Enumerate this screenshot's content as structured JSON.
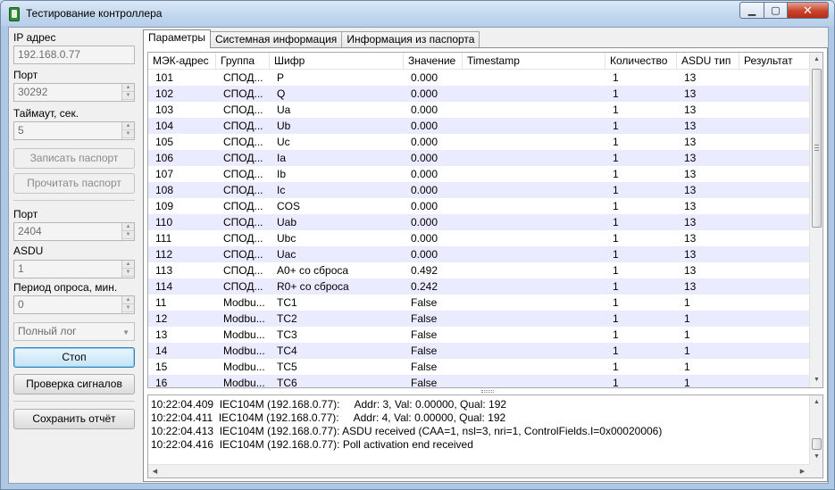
{
  "window": {
    "title": "Тестирование контроллера",
    "minimize_glyph": "▁",
    "maximize_glyph": "▢",
    "close_glyph": "✕"
  },
  "left": {
    "ip_label": "IP адрес",
    "ip_value": "192.168.0.77",
    "port_label": "Порт",
    "port_value": "30292",
    "timeout_label": "Таймаут, сек.",
    "timeout_value": "5",
    "write_passport": "Записать паспорт",
    "read_passport": "Прочитать паспорт",
    "port2_label": "Порт",
    "port2_value": "2404",
    "asdu_label": "ASDU",
    "asdu_value": "1",
    "poll_label": "Период опроса, мин.",
    "poll_value": "0",
    "log_mode": "Полный лог",
    "stop": "Стоп",
    "check_signals": "Проверка сигналов",
    "save_report": "Сохранить отчёт"
  },
  "tabs": [
    "Параметры",
    "Системная информация",
    "Информация из паспорта"
  ],
  "grid": {
    "columns": [
      "МЭК-адрес",
      "Группа",
      "Шифр",
      "Значение",
      "Timestamp",
      "Количество",
      "ASDU тип",
      "Результат"
    ],
    "rows": [
      [
        "101",
        "СПОД...",
        "P",
        "0.000",
        "",
        "1",
        "13",
        ""
      ],
      [
        "102",
        "СПОД...",
        "Q",
        "0.000",
        "",
        "1",
        "13",
        ""
      ],
      [
        "103",
        "СПОД...",
        "Ua",
        "0.000",
        "",
        "1",
        "13",
        ""
      ],
      [
        "104",
        "СПОД...",
        "Ub",
        "0.000",
        "",
        "1",
        "13",
        ""
      ],
      [
        "105",
        "СПОД...",
        "Uc",
        "0.000",
        "",
        "1",
        "13",
        ""
      ],
      [
        "106",
        "СПОД...",
        "Ia",
        "0.000",
        "",
        "1",
        "13",
        ""
      ],
      [
        "107",
        "СПОД...",
        "Ib",
        "0.000",
        "",
        "1",
        "13",
        ""
      ],
      [
        "108",
        "СПОД...",
        "Ic",
        "0.000",
        "",
        "1",
        "13",
        ""
      ],
      [
        "109",
        "СПОД...",
        "COS",
        "0.000",
        "",
        "1",
        "13",
        ""
      ],
      [
        "110",
        "СПОД...",
        "Uab",
        "0.000",
        "",
        "1",
        "13",
        ""
      ],
      [
        "111",
        "СПОД...",
        "Ubc",
        "0.000",
        "",
        "1",
        "13",
        ""
      ],
      [
        "112",
        "СПОД...",
        "Uac",
        "0.000",
        "",
        "1",
        "13",
        ""
      ],
      [
        "113",
        "СПОД...",
        "A0+ со сброса",
        "0.492",
        "",
        "1",
        "13",
        ""
      ],
      [
        "114",
        "СПОД...",
        "R0+ со сброса",
        "0.242",
        "",
        "1",
        "13",
        ""
      ],
      [
        "11",
        "Modbu...",
        "TC1",
        "False",
        "",
        "1",
        "1",
        ""
      ],
      [
        "12",
        "Modbu...",
        "TC2",
        "False",
        "",
        "1",
        "1",
        ""
      ],
      [
        "13",
        "Modbu...",
        "TC3",
        "False",
        "",
        "1",
        "1",
        ""
      ],
      [
        "14",
        "Modbu...",
        "TC4",
        "False",
        "",
        "1",
        "1",
        ""
      ],
      [
        "15",
        "Modbu...",
        "TC5",
        "False",
        "",
        "1",
        "1",
        ""
      ],
      [
        "16",
        "Modbu...",
        "TC6",
        "False",
        "",
        "1",
        "1",
        ""
      ]
    ]
  },
  "log": {
    "lines": [
      "10:22:04.409  IEC104M (192.168.0.77):     Addr: 3, Val: 0.00000, Qual: 192",
      "10:22:04.411  IEC104M (192.168.0.77):     Addr: 4, Val: 0.00000, Qual: 192",
      "10:22:04.413  IEC104M (192.168.0.77): ASDU received (CAA=1, nsl=3, nri=1, ControlFields.I=0x00020006)",
      "10:22:04.416  IEC104M (192.168.0.77): Poll activation end received"
    ]
  },
  "icons": {
    "up": "▲",
    "down": "▼",
    "left": "◀",
    "right": "▶",
    "combo_arrow": "▼"
  }
}
